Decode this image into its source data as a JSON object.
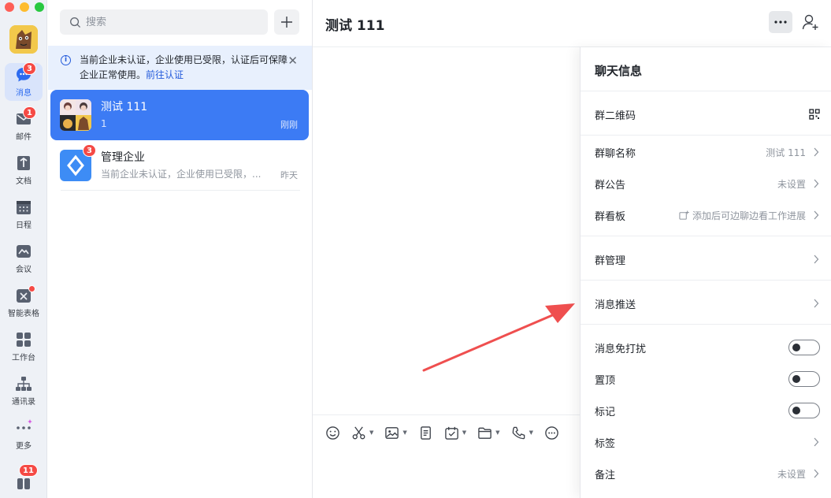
{
  "nav": {
    "items": [
      {
        "key": "messages",
        "label": "消息",
        "badge": "3"
      },
      {
        "key": "mail",
        "label": "邮件",
        "badge": "1"
      },
      {
        "key": "docs",
        "label": "文档"
      },
      {
        "key": "calendar",
        "label": "日程"
      },
      {
        "key": "meeting",
        "label": "会议"
      },
      {
        "key": "sheets",
        "label": "智能表格"
      },
      {
        "key": "workbench",
        "label": "工作台"
      },
      {
        "key": "contacts",
        "label": "通讯录"
      },
      {
        "key": "more",
        "label": "更多"
      }
    ],
    "bottom_badge": "11"
  },
  "search": {
    "placeholder": "搜索"
  },
  "notice": {
    "text": "当前企业未认证，企业使用已受限，认证后可保障企业正常使用。",
    "link": "前往认证"
  },
  "conversations": [
    {
      "name": "测试 111",
      "preview": "1",
      "time": "刚刚"
    },
    {
      "name": "管理企业",
      "preview": "当前企业未认证，企业使用已受限，...",
      "time": "昨天",
      "badge": "3"
    }
  ],
  "chat": {
    "title": "测试 111"
  },
  "panel": {
    "title": "聊天信息",
    "rows": {
      "qrcode": "群二维码",
      "group_name": "群聊名称",
      "group_name_value": "测试 111",
      "announcement": "群公告",
      "announcement_value": "未设置",
      "board": "群看板",
      "board_value": "添加后可边聊边看工作进展",
      "manage": "群管理",
      "push": "消息推送",
      "mute": "消息免打扰",
      "pin": "置顶",
      "mark": "标记",
      "tags": "标签",
      "remark": "备注",
      "remark_value": "未设置"
    },
    "toggles": {
      "mute": false,
      "pin": false,
      "mark": false
    }
  },
  "colors": {
    "accent": "#3c7bf4",
    "badge": "#f54a45",
    "arrow": "#ef4f4f"
  }
}
